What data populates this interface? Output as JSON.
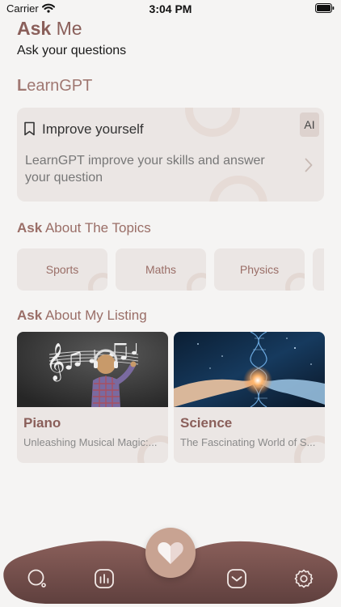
{
  "status_bar": {
    "carrier": "Carrier",
    "time": "3:04 PM"
  },
  "header": {
    "title_bold": "Ask",
    "title_rest": " Me",
    "subtitle": "Ask your questions"
  },
  "brand": {
    "first_letter": "L",
    "rest": "earnGPT"
  },
  "promo": {
    "icon": "bookmark-icon",
    "title": "Improve yourself",
    "badge": "AI",
    "description": "LearnGPT improve your skills and answer your question"
  },
  "topics_section": {
    "title_bold": "Ask",
    "title_rest": " About The Topics",
    "items": [
      {
        "label": "Sports"
      },
      {
        "label": "Maths"
      },
      {
        "label": "Physics"
      }
    ]
  },
  "listing_section": {
    "title_bold": "Ask",
    "title_rest": " About My Listing",
    "items": [
      {
        "title": "Piano",
        "subtitle": "Unleashing Musical Magic:..."
      },
      {
        "title": "Science",
        "subtitle": "The Fascinating World of S..."
      }
    ]
  },
  "tab_bar": {
    "icons": [
      "search-icon",
      "chart-icon",
      "heart-icon",
      "inbox-icon",
      "gear-icon"
    ]
  },
  "colors": {
    "accent": "#8a5f5a",
    "card": "#ebe6e4",
    "tab_bar": "#6b4a48",
    "fab": "#c8a392"
  }
}
